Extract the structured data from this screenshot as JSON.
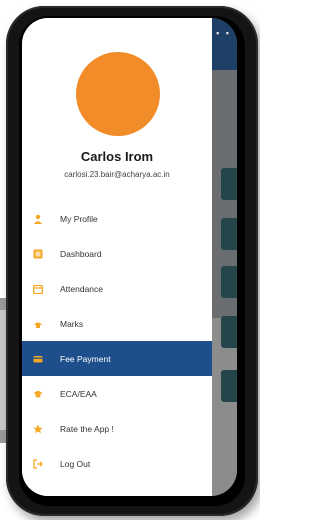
{
  "profile": {
    "name": "Carlos Irom",
    "email": "carlosi.23.bair@acharya.ac.in",
    "avatar_color": "#f28c28"
  },
  "menu": {
    "items": [
      {
        "label": "My Profile",
        "icon": "person-icon",
        "active": false
      },
      {
        "label": "Dashboard",
        "icon": "dashboard-icon",
        "active": false
      },
      {
        "label": "Attendance",
        "icon": "calendar-icon",
        "active": false
      },
      {
        "label": "Marks",
        "icon": "marks-icon",
        "active": false
      },
      {
        "label": "Fee Payment",
        "icon": "payment-icon",
        "active": true
      },
      {
        "label": "ECA/EAA",
        "icon": "graduation-icon",
        "active": false
      },
      {
        "label": "Rate the App !",
        "icon": "star-icon",
        "active": false
      },
      {
        "label": "Log Out",
        "icon": "logout-icon",
        "active": false
      }
    ]
  },
  "colors": {
    "accent": "#f5a623",
    "active_bg": "#1f4e8c",
    "header_bg": "#1e3f66"
  }
}
